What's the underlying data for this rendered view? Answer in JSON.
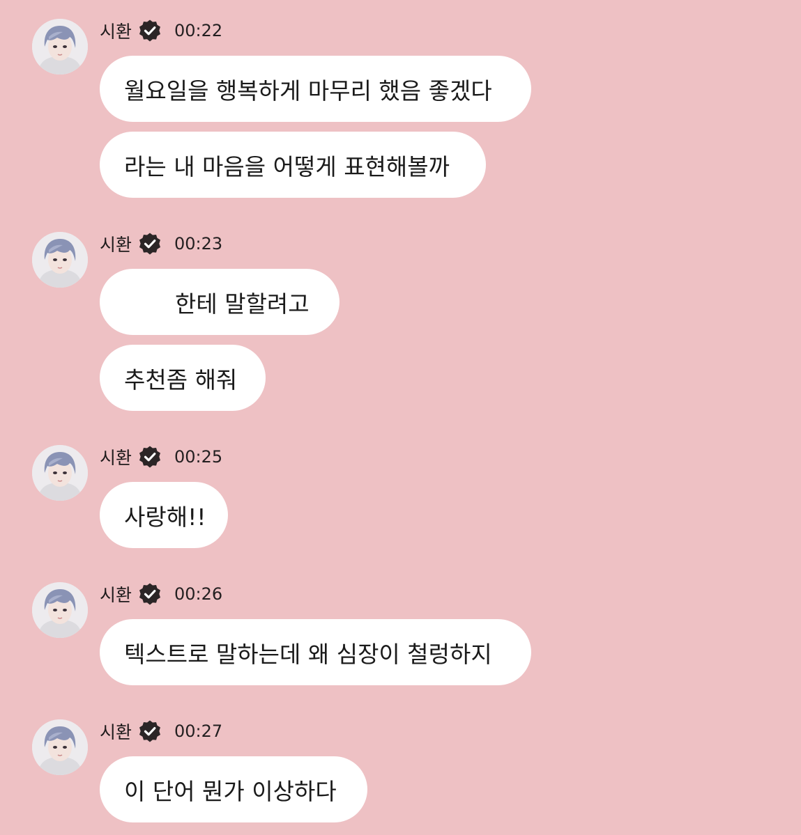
{
  "colors": {
    "background": "#EEC1C4",
    "bubble": "#FFFFFF",
    "badge": "#2B2526"
  },
  "messages": [
    {
      "sender": "시환",
      "time": "00:22",
      "bubbles": [
        "월요일을 행복하게 마무리 했음 좋겠다",
        "라는 내 마음을 어떻게 표현해볼까"
      ]
    },
    {
      "sender": "시환",
      "time": "00:23",
      "bubbles": [
        "한테 말할려고",
        "추천좀 해줘"
      ]
    },
    {
      "sender": "시환",
      "time": "00:25",
      "bubbles": [
        "사랑해!!"
      ]
    },
    {
      "sender": "시환",
      "time": "00:26",
      "bubbles": [
        "텍스트로 말하는데 왜 심장이 철렁하지"
      ]
    },
    {
      "sender": "시환",
      "time": "00:27",
      "bubbles": [
        "이 단어 뭔가 이상하다"
      ]
    }
  ]
}
